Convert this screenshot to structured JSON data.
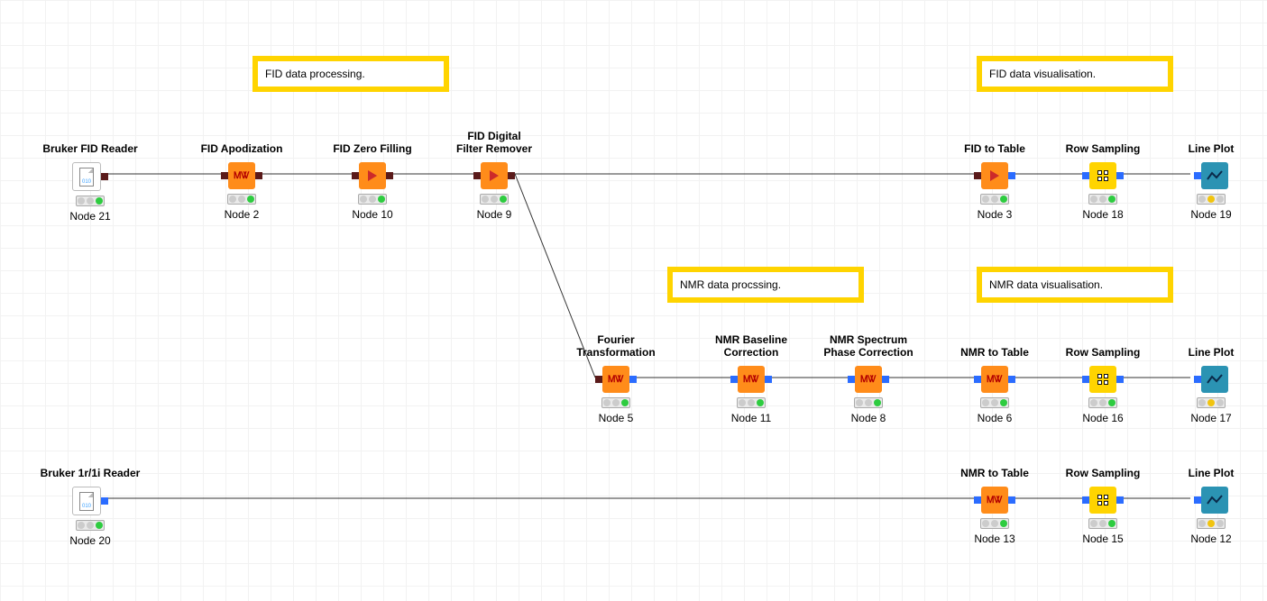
{
  "annotations": [
    {
      "text": "FID data processing."
    },
    {
      "text": "FID data visualisation."
    },
    {
      "text": "NMR data procssing."
    },
    {
      "text": "NMR data visualisation."
    }
  ],
  "nodes": [
    {
      "title": "Bruker FID Reader",
      "id": "Node 21",
      "type": "reader",
      "status": "green"
    },
    {
      "title": "FID Apodization",
      "id": "Node 2",
      "type": "orange-pulse",
      "status": "green"
    },
    {
      "title": "FID Zero Filling",
      "id": "Node 10",
      "type": "orange-arrow",
      "status": "green"
    },
    {
      "title": "FID Digital\nFilter Remover",
      "id": "Node 9",
      "type": "orange-arrow",
      "status": "green"
    },
    {
      "title": "FID to Table",
      "id": "Node 3",
      "type": "orange-arrow",
      "status": "green"
    },
    {
      "title": "Row Sampling",
      "id": "Node 18",
      "type": "yellow-grid",
      "status": "green"
    },
    {
      "title": "Line Plot",
      "id": "Node 19",
      "type": "teal-line",
      "status": "yellow"
    },
    {
      "title": "Fourier\nTransformation",
      "id": "Node 5",
      "type": "orange-pulse",
      "status": "green"
    },
    {
      "title": "NMR Baseline\nCorrection",
      "id": "Node 11",
      "type": "orange-pulse",
      "status": "green"
    },
    {
      "title": "NMR Spectrum\nPhase Correction",
      "id": "Node 8",
      "type": "orange-pulse",
      "status": "green"
    },
    {
      "title": "NMR to Table",
      "id": "Node 6",
      "type": "orange-pulse",
      "status": "green"
    },
    {
      "title": "Row Sampling",
      "id": "Node 16",
      "type": "yellow-grid",
      "status": "green"
    },
    {
      "title": "Line Plot",
      "id": "Node 17",
      "type": "teal-line",
      "status": "yellow"
    },
    {
      "title": "Bruker 1r/1i Reader",
      "id": "Node 20",
      "type": "reader",
      "status": "green"
    },
    {
      "title": "NMR to Table",
      "id": "Node 13",
      "type": "orange-pulse",
      "status": "green"
    },
    {
      "title": "Row Sampling",
      "id": "Node 15",
      "type": "yellow-grid",
      "status": "green"
    },
    {
      "title": "Line Plot",
      "id": "Node 12",
      "type": "teal-line",
      "status": "yellow"
    }
  ],
  "connections": [
    [
      "Node 21",
      "Node 2"
    ],
    [
      "Node 2",
      "Node 10"
    ],
    [
      "Node 10",
      "Node 9"
    ],
    [
      "Node 9",
      "Node 3"
    ],
    [
      "Node 3",
      "Node 18"
    ],
    [
      "Node 18",
      "Node 19"
    ],
    [
      "Node 9",
      "Node 5"
    ],
    [
      "Node 5",
      "Node 11"
    ],
    [
      "Node 11",
      "Node 8"
    ],
    [
      "Node 8",
      "Node 6"
    ],
    [
      "Node 6",
      "Node 16"
    ],
    [
      "Node 16",
      "Node 17"
    ],
    [
      "Node 20",
      "Node 13"
    ],
    [
      "Node 13",
      "Node 15"
    ],
    [
      "Node 15",
      "Node 12"
    ]
  ],
  "colors": {
    "orange": "#ff8c1a",
    "yellow": "#ffd400",
    "teal": "#2b93b3",
    "portDark": "#5a1a1a",
    "portBlue": "#2b6cff"
  }
}
